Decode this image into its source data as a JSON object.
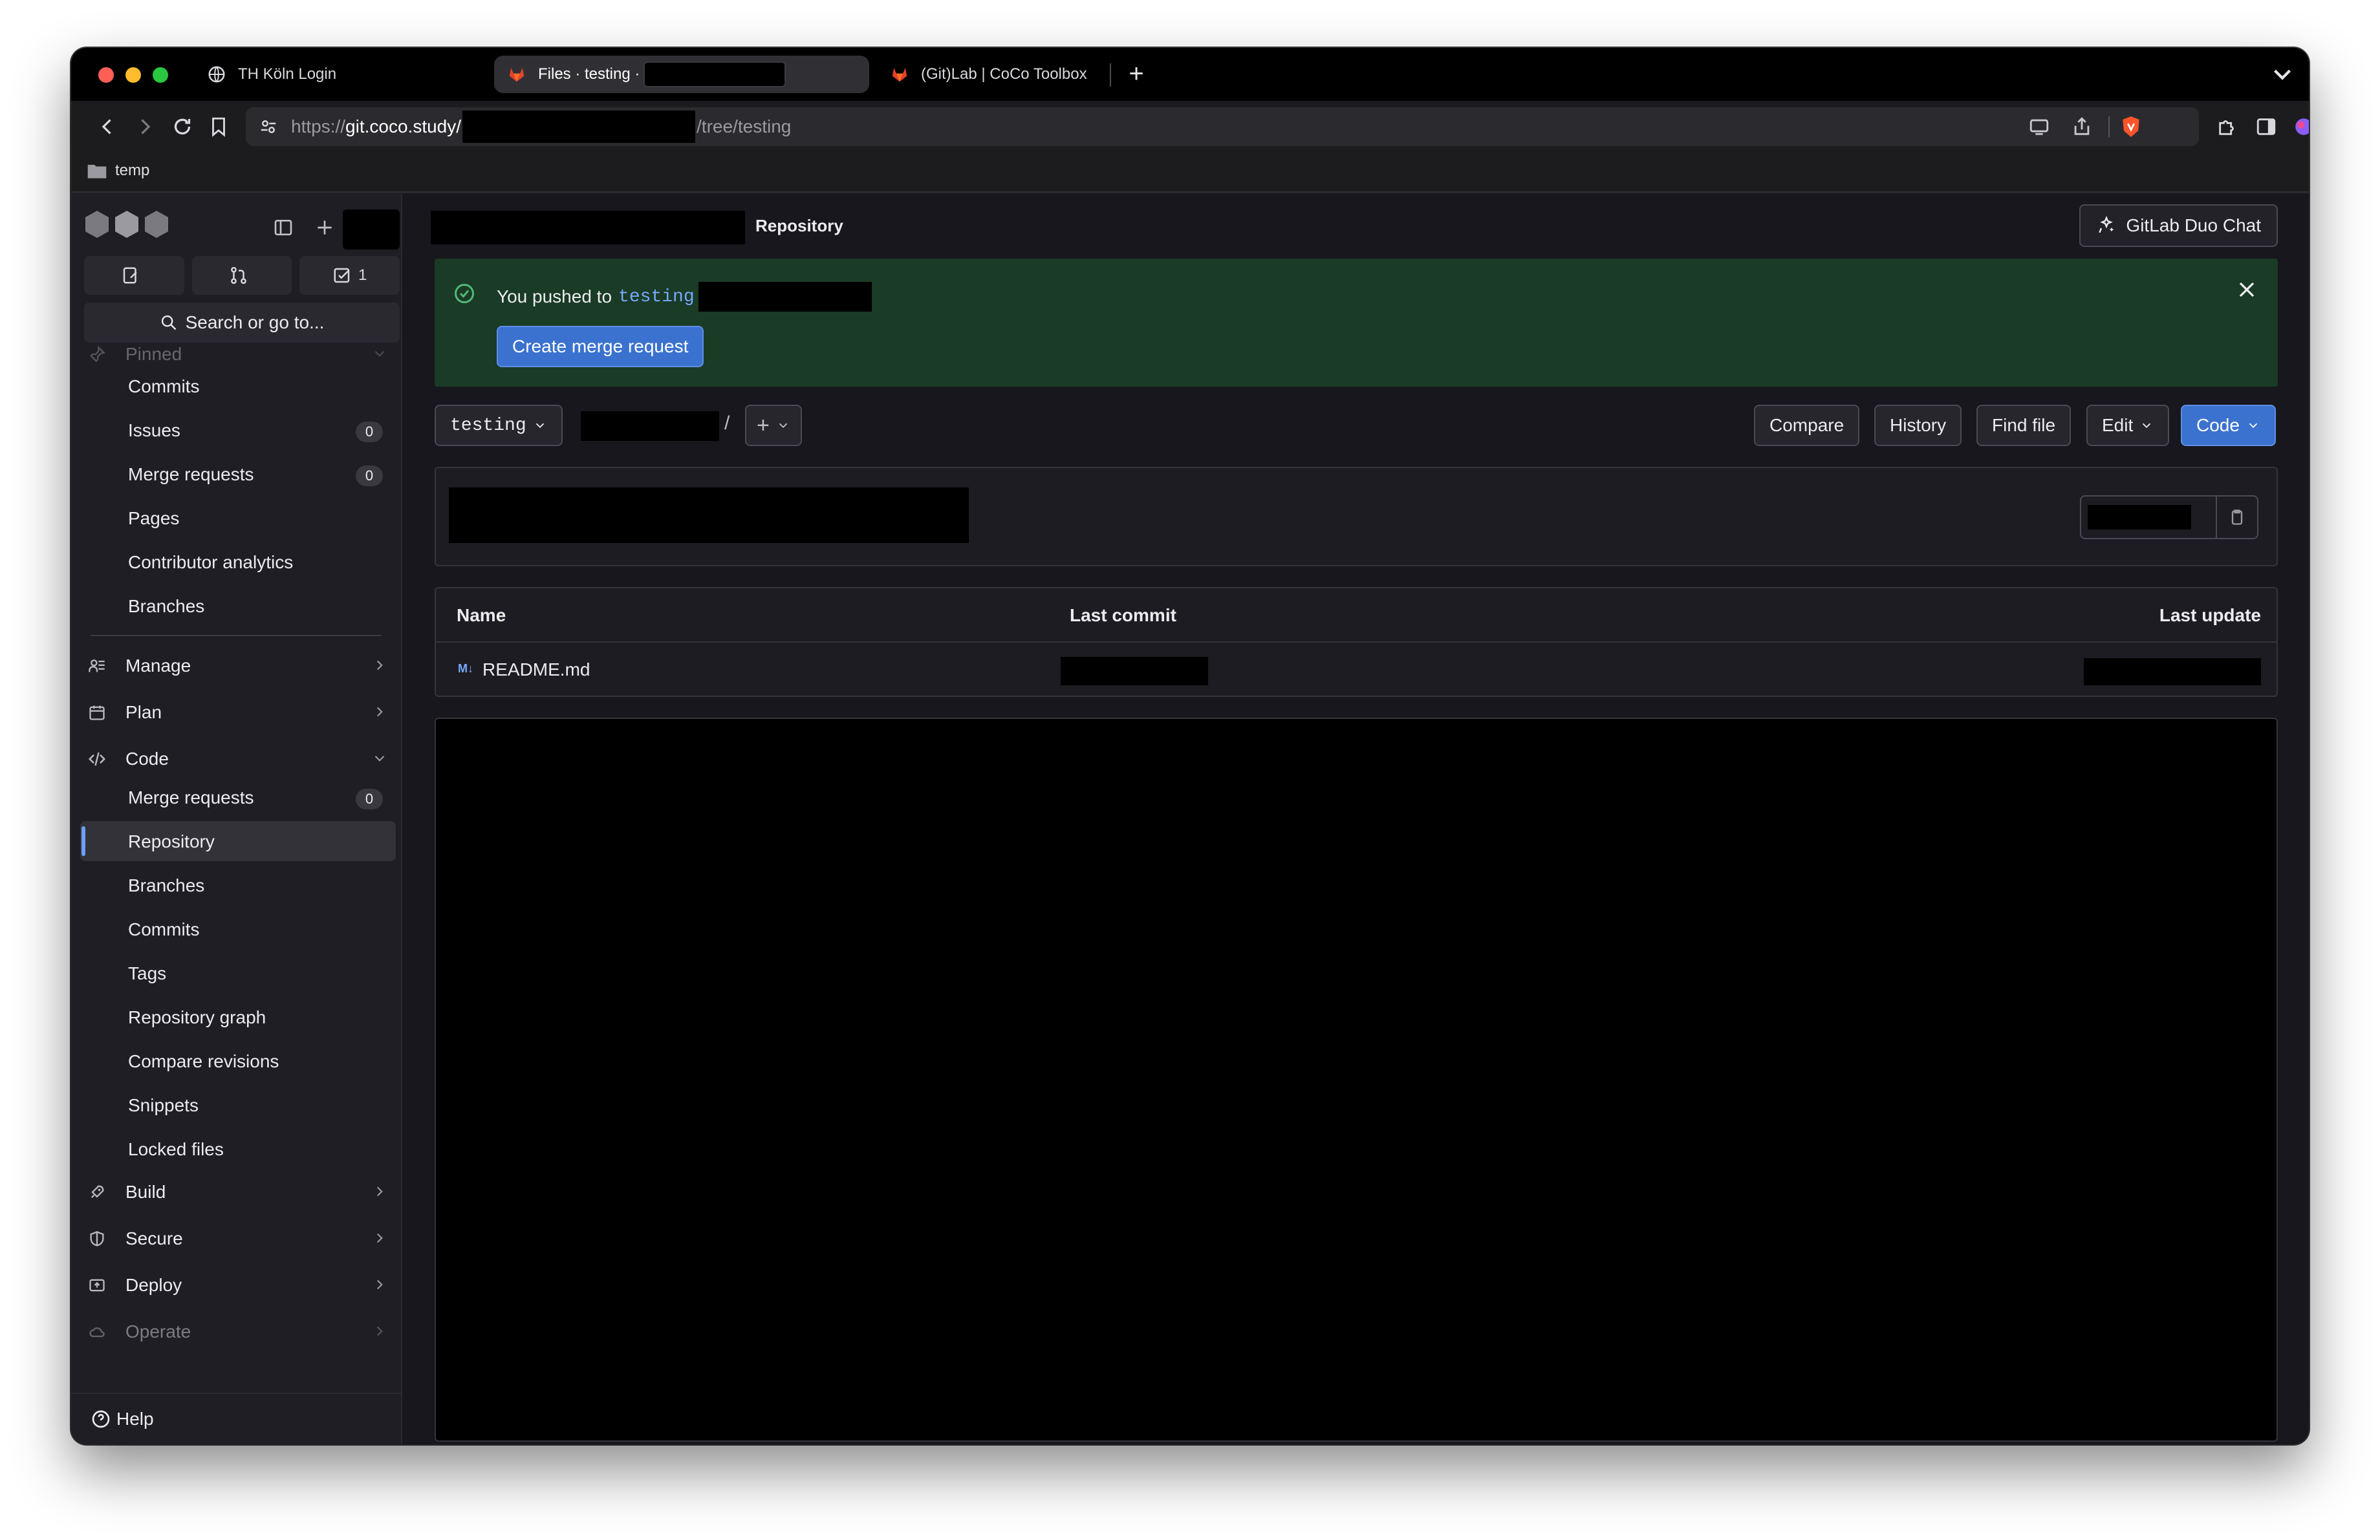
{
  "browser": {
    "tabs": [
      {
        "title": "TH Köln Login"
      },
      {
        "title": "Files · testing ·"
      },
      {
        "title": "(Git)Lab | CoCo Toolbox"
      }
    ],
    "url": {
      "prefix": "https://",
      "host": "git.coco.study",
      "slash": "/",
      "path": "/tree/testing"
    },
    "bookmarks": [
      {
        "label": "temp"
      }
    ]
  },
  "sidebar": {
    "counters": [
      {
        "label": ""
      },
      {
        "label": ""
      },
      {
        "label": "1"
      }
    ],
    "search_label": "Search or go to...",
    "pinned_label": "Pinned",
    "pinned_items": [
      {
        "label": "Commits"
      },
      {
        "label": "Issues",
        "badge": "0"
      },
      {
        "label": "Merge requests",
        "badge": "0"
      },
      {
        "label": "Pages"
      },
      {
        "label": "Contributor analytics"
      },
      {
        "label": "Branches"
      }
    ],
    "sections": {
      "manage": "Manage",
      "plan": "Plan",
      "code": "Code",
      "build": "Build",
      "secure": "Secure",
      "deploy": "Deploy",
      "operate": "Operate"
    },
    "code_items": [
      {
        "label": "Merge requests",
        "badge": "0"
      },
      {
        "label": "Repository"
      },
      {
        "label": "Branches"
      },
      {
        "label": "Commits"
      },
      {
        "label": "Tags"
      },
      {
        "label": "Repository graph"
      },
      {
        "label": "Compare revisions"
      },
      {
        "label": "Snippets"
      },
      {
        "label": "Locked files"
      }
    ],
    "help_label": "Help"
  },
  "header": {
    "breadcrumb_current": "Repository",
    "duo_chat_label": "GitLab Duo Chat"
  },
  "alert": {
    "text": "You pushed to",
    "branch": "testing",
    "button": "Create merge request"
  },
  "repo_toolbar": {
    "branch": "testing",
    "path_sep": "/",
    "add_label": "+",
    "buttons": {
      "compare": "Compare",
      "history": "History",
      "find_file": "Find file",
      "edit": "Edit",
      "code": "Code"
    }
  },
  "files_table": {
    "headers": {
      "name": "Name",
      "last_commit": "Last commit",
      "last_update": "Last update"
    },
    "rows": [
      {
        "icon_text": "M↓",
        "name": "README.md"
      }
    ]
  },
  "colors": {
    "accent": "#3b72cf",
    "alert_bg": "#1a3b25",
    "active_bar": "#6e9fff",
    "page_bg": "#18171d"
  }
}
